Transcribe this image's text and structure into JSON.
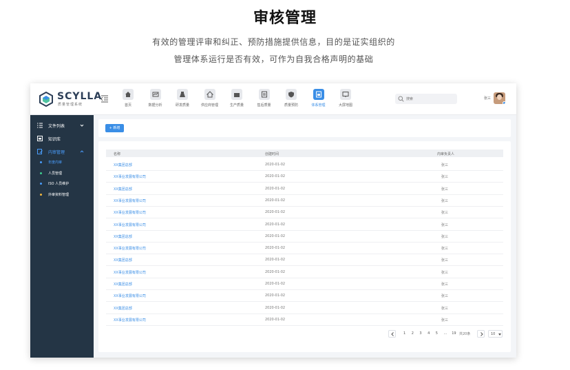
{
  "hero": {
    "title": "审核管理",
    "line1": "有效的管理评审和纠正、预防措施提供信息，目的是证实组织的",
    "line2": "管理体系运行是否有效，可作为自我合格声明的基础"
  },
  "app": {
    "brand": {
      "name": "SCYLLA",
      "subtitle": "质量管理系统"
    },
    "nav": [
      {
        "label": "首页",
        "icon": "home-icon"
      },
      {
        "label": "数据分析",
        "icon": "chart-icon"
      },
      {
        "label": "研发质量",
        "icon": "flask-icon"
      },
      {
        "label": "供应商管理",
        "icon": "store-icon"
      },
      {
        "label": "生产质量",
        "icon": "factory-icon"
      },
      {
        "label": "售后质量",
        "icon": "service-icon"
      },
      {
        "label": "质量预防",
        "icon": "shield-icon"
      },
      {
        "label": "体系管理",
        "icon": "system-icon",
        "active": true
      },
      {
        "label": "大屏地图",
        "icon": "map-icon"
      }
    ],
    "search": {
      "placeholder": "搜索"
    },
    "user": {
      "name": "张三"
    },
    "sidebar": {
      "items": [
        {
          "label": "文件列表",
          "icon": "list-icon"
        },
        {
          "label": "知识库",
          "icon": "book-icon"
        },
        {
          "label": "内审管理",
          "icon": "audit-icon",
          "active": true
        }
      ],
      "subitems": [
        {
          "label": "年度内审",
          "active": true,
          "color": "#4a9eff"
        },
        {
          "label": "人员管理",
          "color": "#3ecf8e"
        },
        {
          "label": "ISO 人员维护",
          "color": "#4a9eff"
        },
        {
          "label": "外审资料管理",
          "color": "#f5b83d"
        }
      ]
    },
    "toolbar": {
      "add_label": "+ 新增"
    },
    "table": {
      "headers": [
        "名称",
        "创建时间",
        "内审负责人"
      ],
      "rows": [
        [
          "XX集团总部",
          "2020-01-02",
          "张三"
        ],
        [
          "XX事业发展有限公司",
          "2020-01-02",
          "张三"
        ],
        [
          "XX集团总部",
          "2020-01-02",
          "张三"
        ],
        [
          "XX事业发展有限公司",
          "2020-01-02",
          "张三"
        ],
        [
          "XX事业发展有限公司",
          "2020-01-02",
          "张三"
        ],
        [
          "XX事业发展有限公司",
          "2020-01-02",
          "张三"
        ],
        [
          "XX集团总部",
          "2020-01-02",
          "张三"
        ],
        [
          "XX事业发展有限公司",
          "2020-01-02",
          "张三"
        ],
        [
          "XX集团总部",
          "2020-01-02",
          "张三"
        ],
        [
          "XX事业发展有限公司",
          "2020-01-02",
          "张三"
        ],
        [
          "XX集团总部",
          "2020-01-02",
          "张三"
        ],
        [
          "XX事业发展有限公司",
          "2020-01-02",
          "张三"
        ],
        [
          "XX集团总部",
          "2020-01-02",
          "张三"
        ],
        [
          "XX事业发展有限公司",
          "2020-01-02",
          "张三"
        ]
      ]
    },
    "pagination": {
      "pages": [
        "1",
        "2",
        "3",
        "4",
        "5",
        "...",
        "19"
      ],
      "total": "共20条",
      "page_size": "10"
    }
  }
}
